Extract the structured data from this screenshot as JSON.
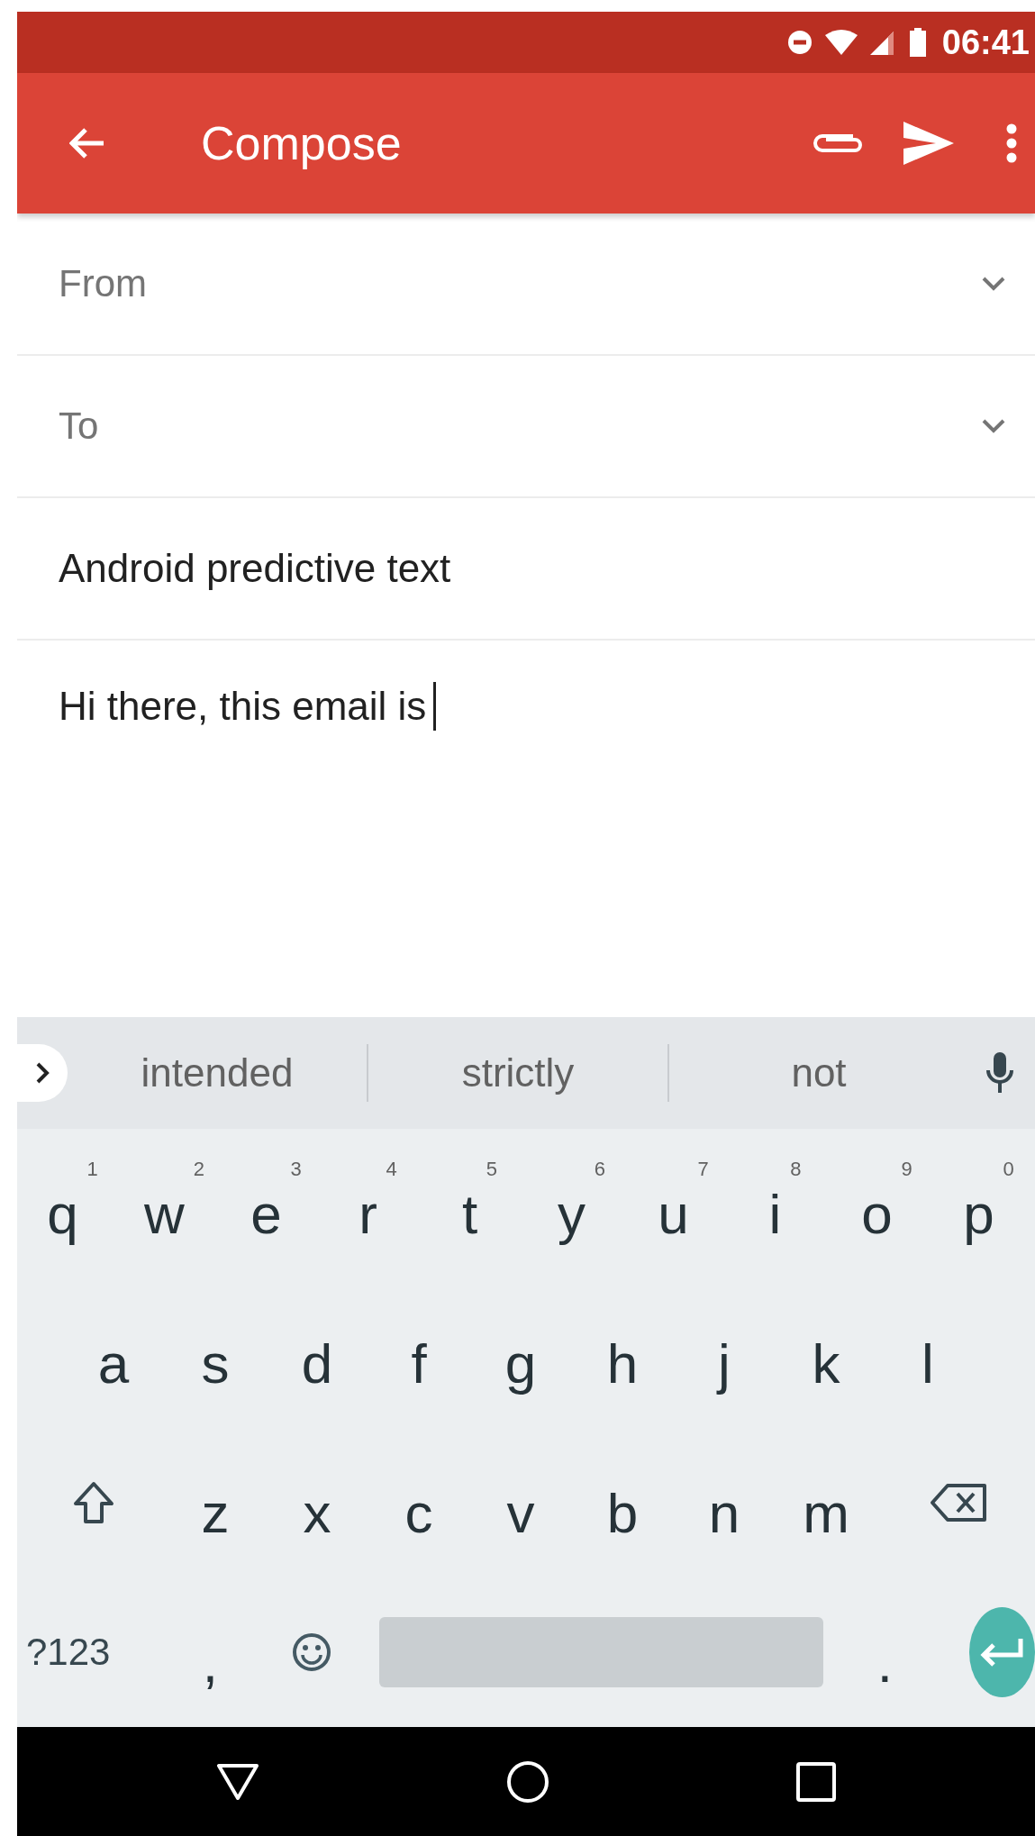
{
  "status_bar": {
    "time": "06:41"
  },
  "toolbar": {
    "title": "Compose"
  },
  "fields": [
    {
      "kind": "select",
      "label": "From"
    },
    {
      "kind": "select",
      "label": "To"
    },
    {
      "kind": "text",
      "value": "Android predictive text",
      "focused": false
    },
    {
      "kind": "text",
      "value": "Hi there, this email is ",
      "focused": true
    }
  ],
  "keyboard": {
    "suggestions": [
      "intended",
      "strictly",
      "not"
    ],
    "rows": [
      [
        {
          "kind": "letter",
          "label": "q",
          "hint": "1"
        },
        {
          "kind": "letter",
          "label": "w",
          "hint": "2"
        },
        {
          "kind": "letter",
          "label": "e",
          "hint": "3"
        },
        {
          "kind": "letter",
          "label": "r",
          "hint": "4"
        },
        {
          "kind": "letter",
          "label": "t",
          "hint": "5"
        },
        {
          "kind": "letter",
          "label": "y",
          "hint": "6"
        },
        {
          "kind": "letter",
          "label": "u",
          "hint": "7"
        },
        {
          "kind": "letter",
          "label": "i",
          "hint": "8"
        },
        {
          "kind": "letter",
          "label": "o",
          "hint": "9"
        },
        {
          "kind": "letter",
          "label": "p",
          "hint": "0"
        }
      ],
      [
        {
          "kind": "letter",
          "label": "a"
        },
        {
          "kind": "letter",
          "label": "s"
        },
        {
          "kind": "letter",
          "label": "d"
        },
        {
          "kind": "letter",
          "label": "f"
        },
        {
          "kind": "letter",
          "label": "g"
        },
        {
          "kind": "letter",
          "label": "h"
        },
        {
          "kind": "letter",
          "label": "j"
        },
        {
          "kind": "letter",
          "label": "k"
        },
        {
          "kind": "letter",
          "label": "l"
        }
      ],
      [
        {
          "kind": "shift"
        },
        {
          "kind": "letter",
          "label": "z"
        },
        {
          "kind": "letter",
          "label": "x"
        },
        {
          "kind": "letter",
          "label": "c"
        },
        {
          "kind": "letter",
          "label": "v"
        },
        {
          "kind": "letter",
          "label": "b"
        },
        {
          "kind": "letter",
          "label": "n"
        },
        {
          "kind": "letter",
          "label": "m"
        },
        {
          "kind": "backspace"
        }
      ],
      [
        {
          "kind": "symbols",
          "label": "?123"
        },
        {
          "kind": "letter",
          "label": ","
        },
        {
          "kind": "emoji"
        },
        {
          "kind": "space"
        },
        {
          "kind": "letter",
          "label": "."
        },
        {
          "kind": "enter"
        }
      ]
    ]
  }
}
